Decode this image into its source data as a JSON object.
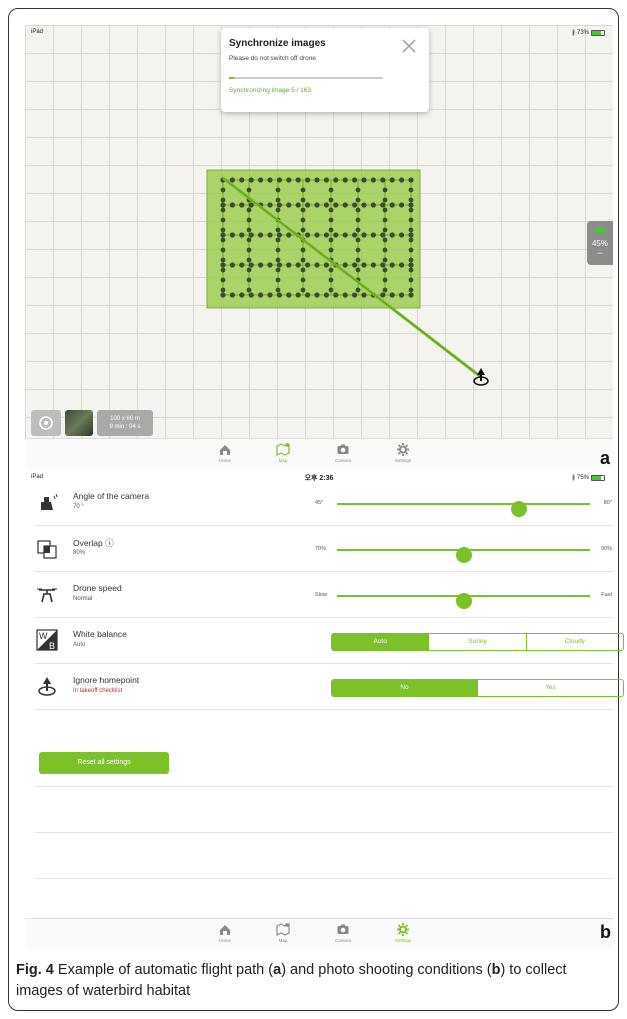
{
  "panel_a": {
    "status": {
      "left": "iPad",
      "time": "오후 2:46",
      "battery": "73%",
      "battery_level": 0.73
    },
    "popup": {
      "title": "Synchronize images",
      "subtitle": "Please do not switch off drone",
      "progress": 0.03,
      "progress_text": "Synchronizing image 5 / 163"
    },
    "battery_widget": {
      "percent": "45%",
      "dots": "•••"
    },
    "info": {
      "size": "100 x 60 m",
      "time": "9 min : 04 s"
    },
    "tabs": [
      {
        "label": "Home",
        "icon": "home-icon",
        "active": false
      },
      {
        "label": "Map",
        "icon": "map-icon",
        "active": true
      },
      {
        "label": "Camera",
        "icon": "camera-icon",
        "active": false
      },
      {
        "label": "Settings",
        "icon": "gear-icon",
        "active": false
      }
    ],
    "letter": "a"
  },
  "panel_b": {
    "status": {
      "left": "iPad",
      "time": "오후 2:36",
      "battery": "75%",
      "battery_level": 0.75
    },
    "settings": [
      {
        "name": "Angle of the camera",
        "value": "70 °",
        "icon": "camera-angle-icon",
        "type": "slider",
        "min_label": "45°",
        "max_label": "80°",
        "level": 0.72
      },
      {
        "name": "Overlap ⓘ",
        "value": "80%",
        "icon": "overlap-icon",
        "type": "slider",
        "min_label": "70%",
        "max_label": "90%",
        "level": 0.5
      },
      {
        "name": "Drone speed",
        "value": "Normal",
        "icon": "drone-icon",
        "type": "slider",
        "min_label": "Slow",
        "max_label": "Fast",
        "level": 0.5
      },
      {
        "name": "White balance",
        "value": "Auto",
        "icon": "white-balance-icon",
        "type": "segment",
        "options": [
          "Auto",
          "Sunny",
          "Cloudy"
        ],
        "selected": 0
      },
      {
        "name": "Ignore homepoint",
        "value": "In takeoff checklist",
        "icon": "homepoint-icon",
        "type": "segment",
        "options": [
          "No",
          "Yes"
        ],
        "selected": 0
      }
    ],
    "reset_label": "Reset all settings",
    "tabs": [
      {
        "label": "Home",
        "icon": "home-icon",
        "active": false
      },
      {
        "label": "Map",
        "icon": "map-icon",
        "active": false
      },
      {
        "label": "Camera",
        "icon": "camera-icon",
        "active": false
      },
      {
        "label": "Settings",
        "icon": "gear-icon",
        "active": true
      }
    ],
    "letter": "b"
  },
  "caption": {
    "fig_label": "Fig. 4",
    "text_1": " Example of automatic flight path (",
    "a": "a",
    "text_2": ") and photo shooting conditions (",
    "b": "b",
    "text_3": ") to collect images of waterbird habitat"
  },
  "colors": {
    "accent": "#7cc02a",
    "area_fill": "#9ccc52",
    "battery": "#4cc23c"
  }
}
